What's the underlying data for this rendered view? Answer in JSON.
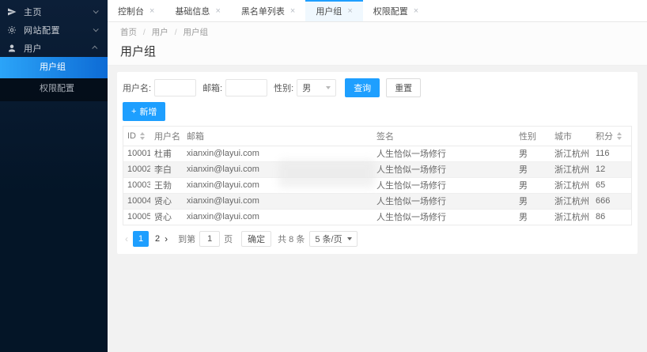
{
  "sidebar": {
    "items": [
      {
        "label": "主页",
        "icon": "send-icon",
        "expanded": false
      },
      {
        "label": "网站配置",
        "icon": "gear-icon",
        "expanded": false
      },
      {
        "label": "用户",
        "icon": "user-icon",
        "expanded": true,
        "children": [
          {
            "label": "用户组",
            "active": true
          },
          {
            "label": "权限配置",
            "active": false
          }
        ]
      }
    ]
  },
  "tabs": [
    {
      "label": "控制台",
      "active": false
    },
    {
      "label": "基础信息",
      "active": false
    },
    {
      "label": "黑名单列表",
      "active": false
    },
    {
      "label": "用户组",
      "active": true
    },
    {
      "label": "权限配置",
      "active": false
    }
  ],
  "glyphs": {
    "close": "×",
    "plus": "+",
    "prev": "‹",
    "next": "›"
  },
  "breadcrumb": {
    "items": [
      "首页",
      "用户",
      "用户组"
    ],
    "separator": "/"
  },
  "page": {
    "title": "用户组"
  },
  "filters": {
    "username_label": "用户名:",
    "email_label": "邮箱:",
    "gender_label": "性别:",
    "gender_value": "男",
    "search_label": "查询",
    "reset_label": "重置"
  },
  "toolbar": {
    "add_label": "新增"
  },
  "table": {
    "headers": [
      "ID",
      "用户名",
      "邮箱",
      "签名",
      "性别",
      "城市",
      "积分"
    ],
    "rows": [
      [
        "10001",
        "杜甫",
        "xianxin@layui.com",
        "人生恰似一场修行",
        "男",
        "浙江杭州",
        "116"
      ],
      [
        "10002",
        "李白",
        "xianxin@layui.com",
        "人生恰似一场修行",
        "男",
        "浙江杭州",
        "12"
      ],
      [
        "10003",
        "王勃",
        "xianxin@layui.com",
        "人生恰似一场修行",
        "男",
        "浙江杭州",
        "65"
      ],
      [
        "10004",
        "贤心",
        "xianxin@layui.com",
        "人生恰似一场修行",
        "男",
        "浙江杭州",
        "666"
      ],
      [
        "10005",
        "贤心",
        "xianxin@layui.com",
        "人生恰似一场修行",
        "男",
        "浙江杭州",
        "86"
      ]
    ]
  },
  "pagination": {
    "pages": [
      {
        "label": "1",
        "active": true
      },
      {
        "label": "2",
        "active": false
      }
    ],
    "goto_prefix": "到第",
    "goto_value": "1",
    "goto_suffix": "页",
    "confirm_label": "确定",
    "total_label": "共 8 条",
    "page_size_label": "5 条/页"
  },
  "colors": {
    "accent": "#1E9FFF",
    "sidebar_bg": "#041527",
    "active_gradient": "#2ba4f8 → #0d6bd5"
  }
}
